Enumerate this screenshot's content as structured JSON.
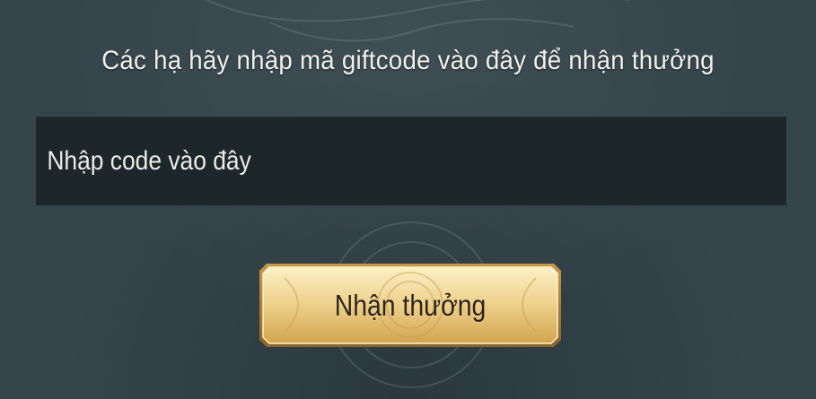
{
  "dialog": {
    "instruction": "Các hạ hãy nhập mã giftcode vào đây để nhận thưởng",
    "code_input": {
      "value": "",
      "placeholder": "Nhập code vào đây"
    },
    "claim_button_label": "Nhận thưởng"
  },
  "colors": {
    "panel_background": "#34454b",
    "input_background": "#1d272a",
    "text_light": "#f2f1ea",
    "button_gold_light": "#f4e2a6",
    "button_gold_dark": "#d9b260",
    "button_border": "#a5793a",
    "button_text": "#2d2418"
  }
}
